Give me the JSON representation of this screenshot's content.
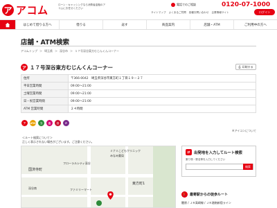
{
  "header": {
    "logo_mark": "ア",
    "logo_text": "アコム",
    "tagline": "ローン・キャッシングなら消費者金融のアコムにお任せください",
    "phone_label": "電話でのご相談",
    "phone_number": "0120-07-1000",
    "util_links": [
      "サイトマップ",
      "よくあるご質問",
      "各種お問い合わせ",
      "企業情報サイト"
    ],
    "login_label": "ログイン"
  },
  "nav": {
    "items": [
      "はじめて借りる方へ",
      "借りる",
      "返す",
      "商品案内",
      "店舗・ATM",
      "ご利用中の方へ"
    ]
  },
  "page": {
    "title": "店舗・ATM検索",
    "breadcrumb": [
      "アコムトップ",
      "埼玉県",
      "深谷市",
      "１７号深谷東方むじんくんコーナー"
    ]
  },
  "shop": {
    "icon_label": "ア",
    "name": "１７号深谷東方むじんくんコーナー",
    "print_label": "印刷する",
    "rows": [
      {
        "label": "住所",
        "value": "〒366-0042　埼玉県深谷市東方町１丁目１９－２７"
      },
      {
        "label": "平日営業時間",
        "value": "09:00～21:00"
      },
      {
        "label": "土曜営業時間",
        "value": "09:00～21:00"
      },
      {
        "label": "日・祝営業時間",
        "value": "09:00～21:00"
      },
      {
        "label": "ATM 営業時間",
        "value": "２４時間"
      }
    ],
    "services": [
      {
        "label": "ア",
        "color": "#e60012"
      },
      {
        "label": "ATM",
        "color": "#e8a000"
      },
      {
        "label": "コ",
        "color": "#2e8b3a"
      },
      {
        "label": "自",
        "color": "#d6006f"
      },
      {
        "label": "ロ",
        "color": "#c8102e"
      },
      {
        "label": "P",
        "color": "#7a2a8a"
      }
    ],
    "icon_note": "※アイコンについて"
  },
  "route_note": {
    "line1": "＜ルート検索について＞",
    "line2": "正しく表示されない場合がございます。ご注意ください。"
  },
  "map": {
    "labels": [
      "国済寺町",
      "フローラルシティ深谷",
      "東方町1",
      "ミナミこどもクリニック",
      "みなみ薬局",
      "深谷南",
      "ファミリーマート"
    ]
  },
  "route_panel": {
    "title": "出発地を入力してルート検索",
    "subtitle": "乗り物・駅名等を入力してください",
    "go_label": "検索"
  },
  "station": {
    "title": "最寄駅からの徒歩ルート",
    "text": "籠原 / ＪＲ高崎線 / ＪＲ湘南新宿ライン"
  }
}
